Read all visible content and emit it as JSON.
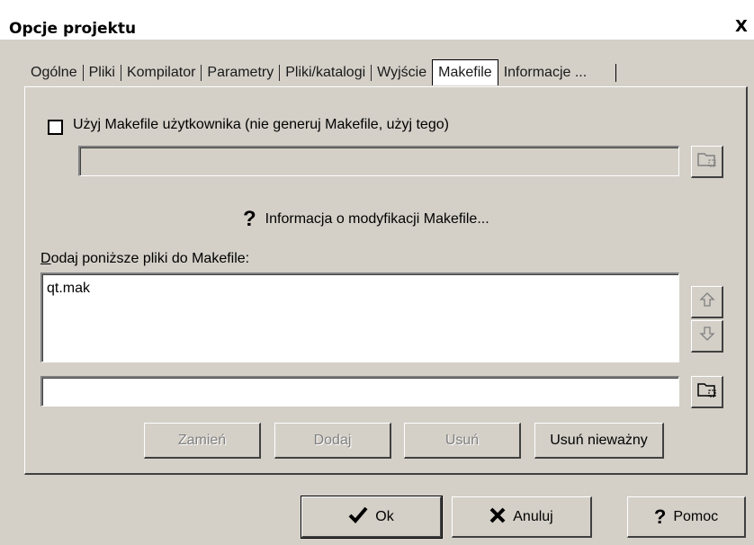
{
  "window": {
    "title": "Opcje projektu",
    "close_label": "X"
  },
  "tabs": [
    {
      "label": "Ogólne"
    },
    {
      "label": "Pliki"
    },
    {
      "label": "Kompilator"
    },
    {
      "label": "Parametry"
    },
    {
      "label": "Pliki/katalogi"
    },
    {
      "label": "Wyjście"
    },
    {
      "label": "Makefile"
    },
    {
      "label": "Informacje ..."
    }
  ],
  "active_tab": "Makefile",
  "makefile": {
    "use_custom_label": "Użyj Makefile użytkownika (nie generuj Makefile, użyj tego)",
    "use_custom_checked": false,
    "custom_path_value": "",
    "help_link": "Informacja o modyfikacji Makefile...",
    "list_label_access": "D",
    "list_label_rest": "odaj poniższe pliki do Makefile:",
    "files": [
      "qt.mak"
    ],
    "new_file_value": "",
    "buttons": {
      "replace": "Zamień",
      "add": "Dodaj",
      "remove": "Usuń",
      "remove_invalid": "Usuń nieważny"
    }
  },
  "footer": {
    "ok": "Ok",
    "cancel": "Anuluj",
    "help": "Pomoc"
  },
  "icons": {
    "folder": "folder-open-icon",
    "up": "arrow-up-icon",
    "down": "arrow-down-icon",
    "help": "question-icon",
    "ok": "checkmark-icon",
    "cancel": "x-cross-icon"
  }
}
